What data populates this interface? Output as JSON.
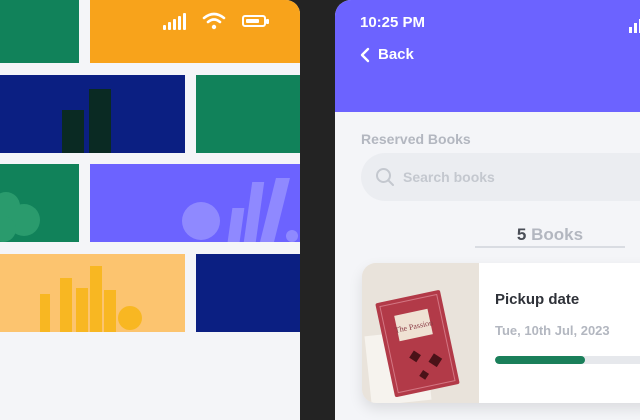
{
  "left_phone": {
    "status": {
      "signal_icon": "signal-icon",
      "wifi_icon": "wifi-icon",
      "battery_icon": "battery-icon",
      "battery_level": 0.8
    },
    "colors": {
      "orange": "#f8a31b",
      "green": "#11825a",
      "navy": "#0b1f82",
      "purple": "#6c63ff",
      "light_orange": "#fcc46f"
    }
  },
  "right_phone": {
    "status_time": "10:25 PM",
    "back_label": "Back",
    "section_label": "Reserved Books",
    "search_placeholder": "Search books",
    "count_number": "5",
    "count_unit": "Books",
    "card": {
      "title": "Pickup date",
      "date": "Tue, 10th Jul, 2023",
      "progress": 0.45,
      "cover_title": "The Passion"
    },
    "colors": {
      "header": "#6c63ff",
      "progress": "#1a7f5a"
    }
  }
}
